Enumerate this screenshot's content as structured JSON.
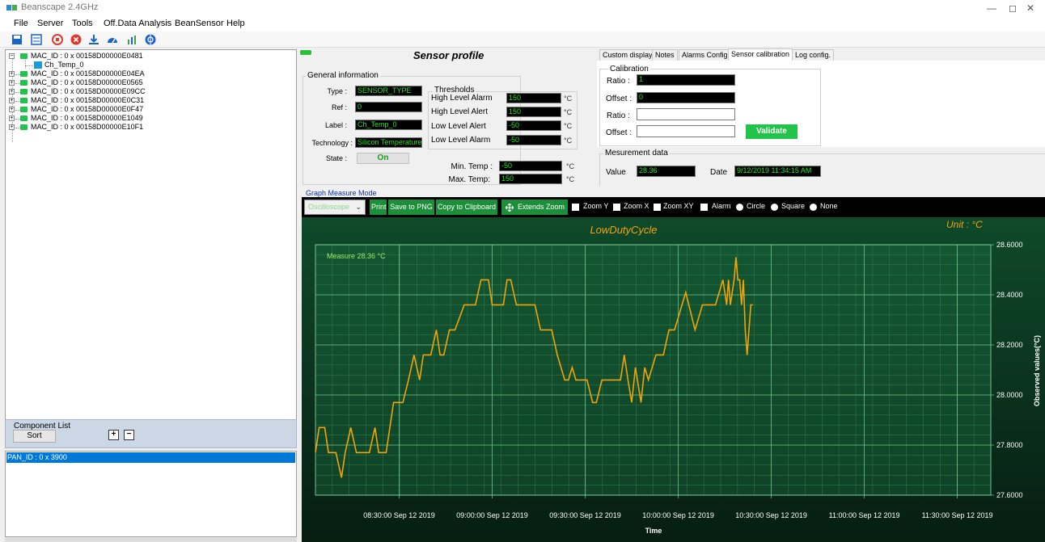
{
  "window": {
    "title": "Beanscape 2.4GHz"
  },
  "menu": [
    "File",
    "Server",
    "Tools",
    "Off.Data Analysis",
    "BeanSensor",
    "Help"
  ],
  "tree": {
    "nodes": [
      {
        "label": "MAC_ID : 0 x 00158D00000E0481",
        "expanded": true,
        "children": [
          "Ch_Temp_0"
        ]
      },
      {
        "label": "MAC_ID : 0 x 00158D00000E04EA"
      },
      {
        "label": "MAC_ID : 0 x 00158D00000E0565"
      },
      {
        "label": "MAC_ID : 0 x 00158D00000E09CC"
      },
      {
        "label": "MAC_ID : 0 x 00158D00000E0C31"
      },
      {
        "label": "MAC_ID : 0 x 00158D00000E0F47"
      },
      {
        "label": "MAC_ID : 0 x 00158D00000E1049"
      },
      {
        "label": "MAC_ID : 0 x 00158D00000E10F1"
      }
    ]
  },
  "component_list": {
    "legend": "Component List",
    "sort_label": "Sort",
    "plus": "+",
    "minus": "−"
  },
  "pan": {
    "row": "PAN_ID : 0 x 3900"
  },
  "profile": {
    "title": "Sensor profile",
    "general_legend": "General information",
    "type_label": "Type :",
    "type_value": "SENSOR_TYPE",
    "ref_label": "Ref :",
    "ref_value": "0",
    "label_label": "Label :",
    "label_value": "Ch_Temp_0",
    "tech_label": "Technology :",
    "tech_value": "Silicon Temperature",
    "state_label": "State :",
    "state_value": "On",
    "thresholds_legend": "Thresholds",
    "hla_label": "High Level Alarm",
    "hla_value": "150",
    "hlal_label": "High Level Alert",
    "hlal_value": "150",
    "lla_label": "Low Level Alert",
    "lla_value": "-50",
    "llam_label": "Low Level Alarm",
    "llam_value": "-50",
    "unit_c": "°C",
    "min_label": "Min. Temp :",
    "min_value": "-50",
    "max_label": "Max. Temp:",
    "max_value": "150"
  },
  "tabs": [
    "Custom display",
    "Notes",
    "Alarms Config",
    "Sensor calibration",
    "Log config."
  ],
  "active_tab": "Sensor calibration",
  "calibration": {
    "legend": "Calibration",
    "ratio_label": "Ratio :",
    "ratio_value": "1",
    "offset_label": "Offset :",
    "offset_value": "0",
    "ratio2_label": "Ratio :",
    "offset2_label": "Offset :",
    "validate_label": "Validate"
  },
  "measurement": {
    "legend": "Mesurement data",
    "value_label": "Value",
    "value": "28.36",
    "date_label": "Date",
    "date": "9/12/2019 11:34:15 AM"
  },
  "graph_mode_label": "Graph Measure Mode",
  "graph_toolbar": {
    "mode": "Oscilloscope",
    "print": "Print",
    "save_png": "Save to PNG",
    "copy": "Copy to Clipboard",
    "extends_zoom": "Extends Zoom",
    "zoom_y": "Zoom Y",
    "zoom_x": "Zoom X",
    "zoom_xy": "Zoom XY",
    "alarm": "Alarm",
    "circle": "Circle",
    "square": "Square",
    "none": "None"
  },
  "colors": {
    "chart_bg": "#0e3a22",
    "line": "#f0a30a",
    "accent_green": "#22c34a",
    "selection": "#0078d7"
  },
  "chart_data": {
    "type": "line",
    "title": "LowDutyCycle",
    "unit_label": "Unit : °C",
    "measure_label": "Measure 28.36 °C",
    "xlabel": "Time",
    "ylabel": "Observed values(°C)",
    "ylim": [
      27.6,
      28.6
    ],
    "y_ticks": [
      "28.6000",
      "28.4000",
      "28.2000",
      "28.0000",
      "27.8000",
      "27.6000"
    ],
    "x_ticks": [
      "08:30:00 Sep 12 2019",
      "09:00:00 Sep 12 2019",
      "09:30:00 Sep 12 2019",
      "10:00:00 Sep 12 2019",
      "10:30:00 Sep 12 2019",
      "11:00:00 Sep 12 2019",
      "11:30:00 Sep 12 2019"
    ],
    "x_range_min": [
      8.05,
      11.68
    ],
    "series": [
      {
        "values": [
          [
            8.05,
            27.77
          ],
          [
            8.07,
            27.87
          ],
          [
            8.1,
            27.87
          ],
          [
            8.12,
            27.77
          ],
          [
            8.16,
            27.77
          ],
          [
            8.19,
            27.67
          ],
          [
            8.21,
            27.77
          ],
          [
            8.24,
            27.87
          ],
          [
            8.27,
            27.77
          ],
          [
            8.34,
            27.77
          ],
          [
            8.37,
            27.87
          ],
          [
            8.39,
            27.77
          ],
          [
            8.43,
            27.77
          ],
          [
            8.47,
            27.97
          ],
          [
            8.52,
            27.97
          ],
          [
            8.55,
            28.06
          ],
          [
            8.58,
            28.16
          ],
          [
            8.61,
            28.06
          ],
          [
            8.63,
            28.16
          ],
          [
            8.67,
            28.16
          ],
          [
            8.7,
            28.26
          ],
          [
            8.72,
            28.16
          ],
          [
            8.74,
            28.16
          ],
          [
            8.77,
            28.26
          ],
          [
            8.8,
            28.26
          ],
          [
            8.85,
            28.36
          ],
          [
            8.91,
            28.36
          ],
          [
            8.94,
            28.46
          ],
          [
            8.98,
            28.46
          ],
          [
            9.0,
            28.36
          ],
          [
            9.06,
            28.36
          ],
          [
            9.08,
            28.46
          ],
          [
            9.1,
            28.46
          ],
          [
            9.13,
            28.36
          ],
          [
            9.23,
            28.36
          ],
          [
            9.26,
            28.26
          ],
          [
            9.32,
            28.26
          ],
          [
            9.35,
            28.16
          ],
          [
            9.39,
            28.06
          ],
          [
            9.41,
            28.06
          ],
          [
            9.43,
            28.11
          ],
          [
            9.45,
            28.06
          ],
          [
            9.51,
            28.06
          ],
          [
            9.54,
            27.97
          ],
          [
            9.56,
            27.97
          ],
          [
            9.59,
            28.06
          ],
          [
            9.69,
            28.06
          ],
          [
            9.71,
            28.16
          ],
          [
            9.73,
            28.06
          ],
          [
            9.75,
            27.97
          ],
          [
            9.77,
            28.11
          ],
          [
            9.8,
            27.97
          ],
          [
            9.82,
            28.11
          ],
          [
            9.84,
            28.06
          ],
          [
            9.86,
            28.11
          ],
          [
            9.88,
            28.16
          ],
          [
            9.92,
            28.16
          ],
          [
            9.95,
            28.26
          ],
          [
            9.98,
            28.26
          ],
          [
            10.04,
            28.41
          ],
          [
            10.09,
            28.26
          ],
          [
            10.13,
            28.36
          ],
          [
            10.2,
            28.36
          ],
          [
            10.24,
            28.46
          ],
          [
            10.26,
            28.36
          ],
          [
            10.27,
            28.46
          ],
          [
            10.28,
            28.36
          ],
          [
            10.3,
            28.46
          ],
          [
            10.31,
            28.55
          ],
          [
            10.32,
            28.46
          ],
          [
            10.33,
            28.46
          ],
          [
            10.34,
            28.36
          ],
          [
            10.35,
            28.46
          ],
          [
            10.36,
            28.26
          ],
          [
            10.37,
            28.16
          ],
          [
            10.38,
            28.26
          ],
          [
            10.39,
            28.36
          ],
          [
            10.4,
            28.36
          ]
        ]
      }
    ]
  }
}
